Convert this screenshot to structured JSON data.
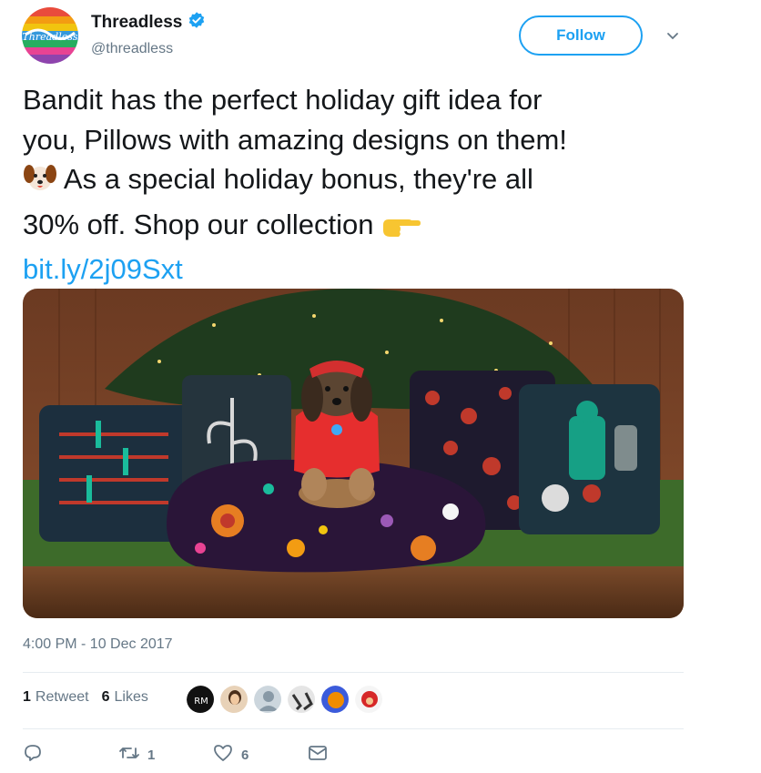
{
  "account": {
    "display_name": "Threadless",
    "handle": "@threadless",
    "verified": true
  },
  "header": {
    "follow_label": "Follow",
    "accent_color": "#1da1f2"
  },
  "tweet": {
    "line1": "Bandit has the perfect holiday gift idea for",
    "line2": "you, Pillows with amazing designs on them!",
    "line3": " As a special holiday bonus, they're all",
    "line4": "30% off. Shop our collection ",
    "link": "bit.ly/2j09Sxt",
    "emojis": [
      "dog-face",
      "pointing-right-hand"
    ]
  },
  "timestamp": "4:00 PM - 10 Dec 2017",
  "stats": {
    "retweets_count": "1",
    "retweets_label": "Retweet",
    "likes_count": "6",
    "likes_label": "Likes",
    "likers": [
      {
        "initials": "RM"
      },
      {
        "initials": ""
      },
      {
        "initials": ""
      },
      {
        "initials": ""
      },
      {
        "initials": ""
      },
      {
        "initials": ""
      }
    ]
  },
  "actions": {
    "retweet_count": "1",
    "like_count": "6"
  }
}
